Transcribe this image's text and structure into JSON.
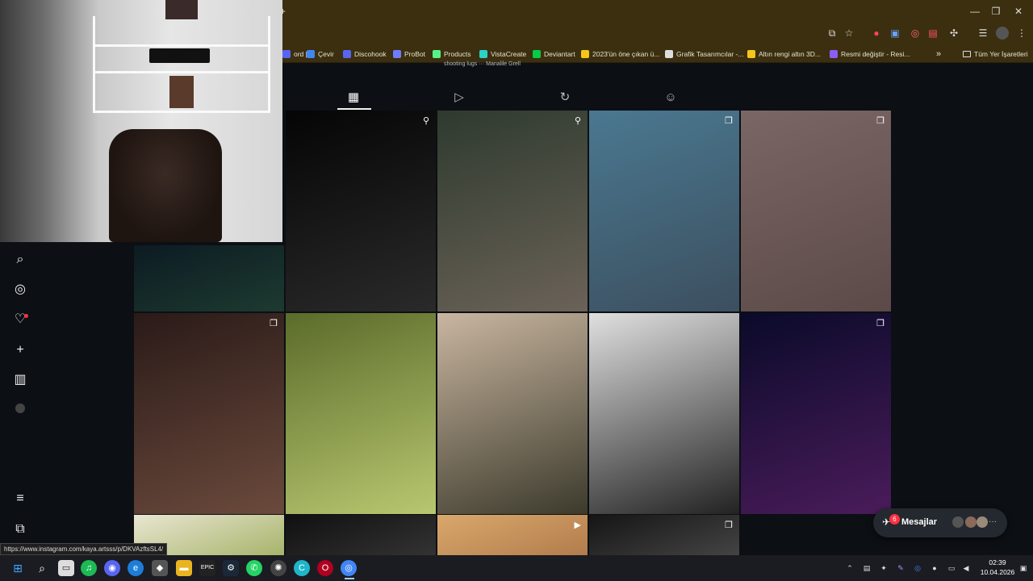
{
  "browser": {
    "bookmarks": [
      {
        "label": "ord |",
        "color": "#5865f2"
      },
      {
        "label": "Çevir",
        "color": "#4285f4"
      },
      {
        "label": "Discohook",
        "color": "#5865f2"
      },
      {
        "label": "ProBot",
        "color": "#6e7dff"
      },
      {
        "label": "Products",
        "color": "#57f287"
      },
      {
        "label": "VistaCreate",
        "color": "#2ad1c9"
      },
      {
        "label": "Deviantart",
        "color": "#05cc47"
      },
      {
        "label": "2023'ün öne çıkan ü...",
        "color": "#f5c518"
      },
      {
        "label": "Grafik Tasarımcılar -...",
        "color": "#dddddd"
      },
      {
        "label": "Altın rengi altın 3D...",
        "color": "#f5c518"
      },
      {
        "label": "Resmi değiştir - Resi...",
        "color": "#8c5cf5"
      }
    ],
    "all_bookmarks": "Tüm Yer İşaretleri",
    "more_chevron": "»"
  },
  "page": {
    "under_strip": "shooting lugs ··· Manalile Grell",
    "tabs": [
      {
        "name": "grid-icon",
        "glyph": "▦"
      },
      {
        "name": "reels-icon",
        "glyph": "▷"
      },
      {
        "name": "reposts-icon",
        "glyph": "↻"
      },
      {
        "name": "tagged-icon",
        "glyph": "☺"
      }
    ]
  },
  "sidebar": {
    "icons": [
      "search-icon",
      "explore-icon",
      "notifications-icon",
      "create-icon",
      "insights-icon",
      "profile-avatar",
      "menu-icon",
      "apps-icon"
    ]
  },
  "posts": [
    {
      "name": "post-1",
      "badge": "pin",
      "colors": [
        "#0c1b22",
        "#1d3a30"
      ]
    },
    {
      "name": "post-2",
      "badge": "pin",
      "colors": [
        "#050505",
        "#2a2a2a"
      ]
    },
    {
      "name": "post-3",
      "badge": "pin",
      "colors": [
        "#2e3a2e",
        "#6b6258"
      ]
    },
    {
      "name": "post-4",
      "badge": "carousel",
      "colors": [
        "#4a7890",
        "#3c4f5f"
      ]
    },
    {
      "name": "post-5",
      "badge": "carousel",
      "colors": [
        "#7a6765",
        "#5c4a48"
      ]
    },
    {
      "name": "post-6",
      "badge": "carousel",
      "colors": [
        "#2a1a18",
        "#6b4a3c"
      ]
    },
    {
      "name": "post-7",
      "badge": "none",
      "colors": [
        "#5b6b2a",
        "#b8c870"
      ]
    },
    {
      "name": "post-8",
      "badge": "none",
      "colors": [
        "#c9b6a0",
        "#3c3a2c"
      ]
    },
    {
      "name": "post-9",
      "badge": "none",
      "colors": [
        "#e0e0e0",
        "#222222"
      ]
    },
    {
      "name": "post-10",
      "badge": "carousel",
      "colors": [
        "#0a0a2a",
        "#4a1c5a"
      ]
    },
    {
      "name": "post-11",
      "badge": "none",
      "colors": [
        "#e9e6d2",
        "#a7b46a"
      ]
    },
    {
      "name": "post-12",
      "badge": "none",
      "colors": [
        "#101010",
        "#333333"
      ]
    },
    {
      "name": "post-13",
      "badge": "reel",
      "colors": [
        "#d9a86c",
        "#b37c4c"
      ]
    },
    {
      "name": "post-14",
      "badge": "carousel",
      "colors": [
        "#151515",
        "#444444"
      ]
    }
  ],
  "messages": {
    "label": "Mesajlar",
    "count": "6",
    "more": "···"
  },
  "status_url": "https://www.instagram.com/kaya.artsss/p/DKVAzftsSL4/",
  "taskbar": {
    "clock_time": "02:39",
    "clock_date": "10.04.2026"
  }
}
